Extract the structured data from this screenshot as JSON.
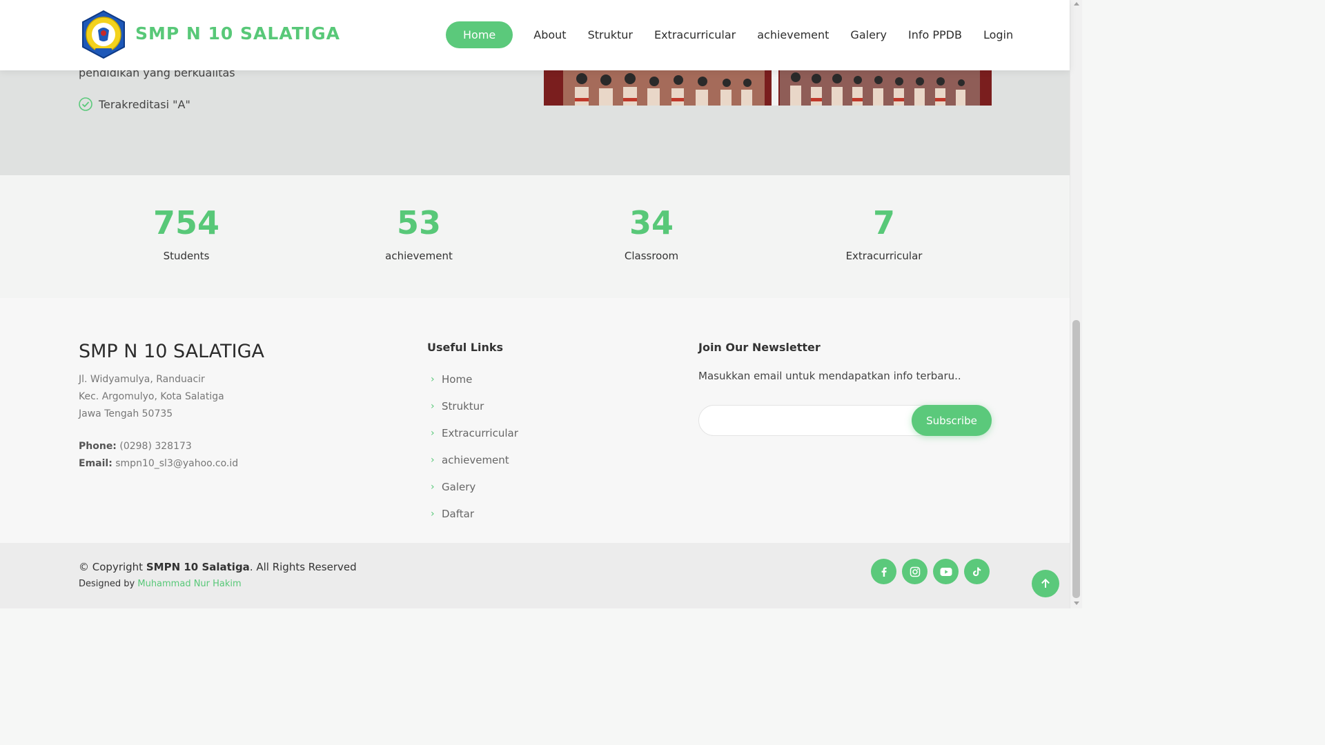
{
  "header": {
    "brand": "SMP N 10 SALATIGA",
    "nav": [
      {
        "label": "Home",
        "active": true
      },
      {
        "label": "About"
      },
      {
        "label": "Struktur"
      },
      {
        "label": "Extracurricular"
      },
      {
        "label": "achievement"
      },
      {
        "label": "Galery"
      },
      {
        "label": "Info PPDB"
      },
      {
        "label": "Login"
      }
    ]
  },
  "hero": {
    "text_fragment": "pendidikan yang berkualitas",
    "check_item": "Terakreditasi \"A\""
  },
  "stats": [
    {
      "value": "754",
      "label": "Students"
    },
    {
      "value": "53",
      "label": "achievement"
    },
    {
      "value": "34",
      "label": "Classroom"
    },
    {
      "value": "7",
      "label": "Extracurricular"
    }
  ],
  "footer": {
    "title": "SMP N 10 SALATIGA",
    "address": [
      "Jl. Widyamulya, Randuacir",
      "Kec. Argomulyo, Kota Salatiga",
      "Jawa Tengah 50735"
    ],
    "phone_label": "Phone:",
    "phone": "(0298) 328173",
    "email_label": "Email:",
    "email": "smpn10_sl3@yahoo.co.id",
    "useful_links_title": "Useful Links",
    "useful_links": [
      "Home",
      "Struktur",
      "Extracurricular",
      "achievement",
      "Galery",
      "Daftar"
    ],
    "newsletter_title": "Join Our Newsletter",
    "newsletter_text": "Masukkan email untuk mendapatkan info terbaru..",
    "newsletter_input_value": "",
    "subscribe_label": "Subscribe"
  },
  "bottom": {
    "copyright_prefix": "© Copyright",
    "copyright_name": "SMPN 10 Salatiga",
    "copyright_suffix": ". All Rights Reserved",
    "designed_prefix": "Designed by",
    "designer": "Muhammad Nur Hakim",
    "social": [
      "facebook-icon",
      "instagram-icon",
      "youtube-icon",
      "tiktok-icon"
    ]
  },
  "colors": {
    "accent": "#5bc97b",
    "brand_text": "#58c878",
    "hero_bg": "#dfe1e0"
  }
}
